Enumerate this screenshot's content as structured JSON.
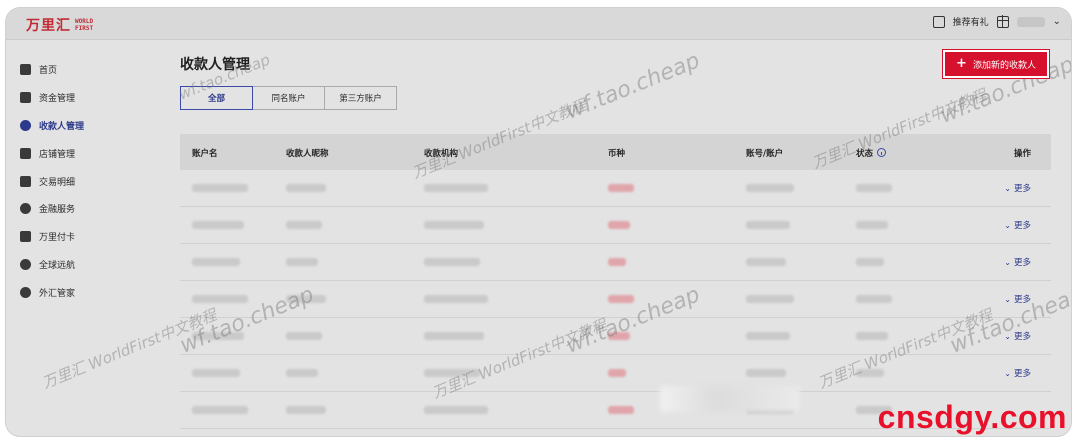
{
  "brand": {
    "name_cn": "万里汇",
    "name_en_line1": "WORLD",
    "name_en_line2": "FIRST",
    "color": "#c22b36"
  },
  "topbar": {
    "referral_label": "推荐有礼",
    "referral_icon": "inbox-icon",
    "gift_icon": "gift-icon"
  },
  "sidebar": {
    "items": [
      {
        "label": "首页",
        "icon": "home-icon"
      },
      {
        "label": "资金管理",
        "icon": "wallet-icon"
      },
      {
        "label": "收款人管理",
        "icon": "payee-icon",
        "active": true
      },
      {
        "label": "店铺管理",
        "icon": "store-icon"
      },
      {
        "label": "交易明细",
        "icon": "ledger-icon"
      },
      {
        "label": "金融服务",
        "icon": "finance-icon"
      },
      {
        "label": "万里付卡",
        "icon": "card-icon"
      },
      {
        "label": "全球远航",
        "icon": "globe-icon"
      },
      {
        "label": "外汇管家",
        "icon": "fx-icon"
      }
    ]
  },
  "main": {
    "title": "收款人管理",
    "add_button": "添加新的收款人",
    "tabs": [
      {
        "label": "全部",
        "active": true
      },
      {
        "label": "同名账户"
      },
      {
        "label": "第三方账户"
      }
    ],
    "table": {
      "columns": [
        "账户名",
        "收款人昵称",
        "收款机构",
        "币种",
        "账号/账户",
        "状态",
        "操作"
      ],
      "row_action": "更多",
      "row_count": 7
    }
  },
  "watermarks": [
    "万里汇 WorldFirst中文教程",
    "wf.tao.cheap"
  ],
  "site_mark": "cnsdgy.com",
  "colors": {
    "accent": "#d5112e",
    "link": "#2d3a8c"
  }
}
